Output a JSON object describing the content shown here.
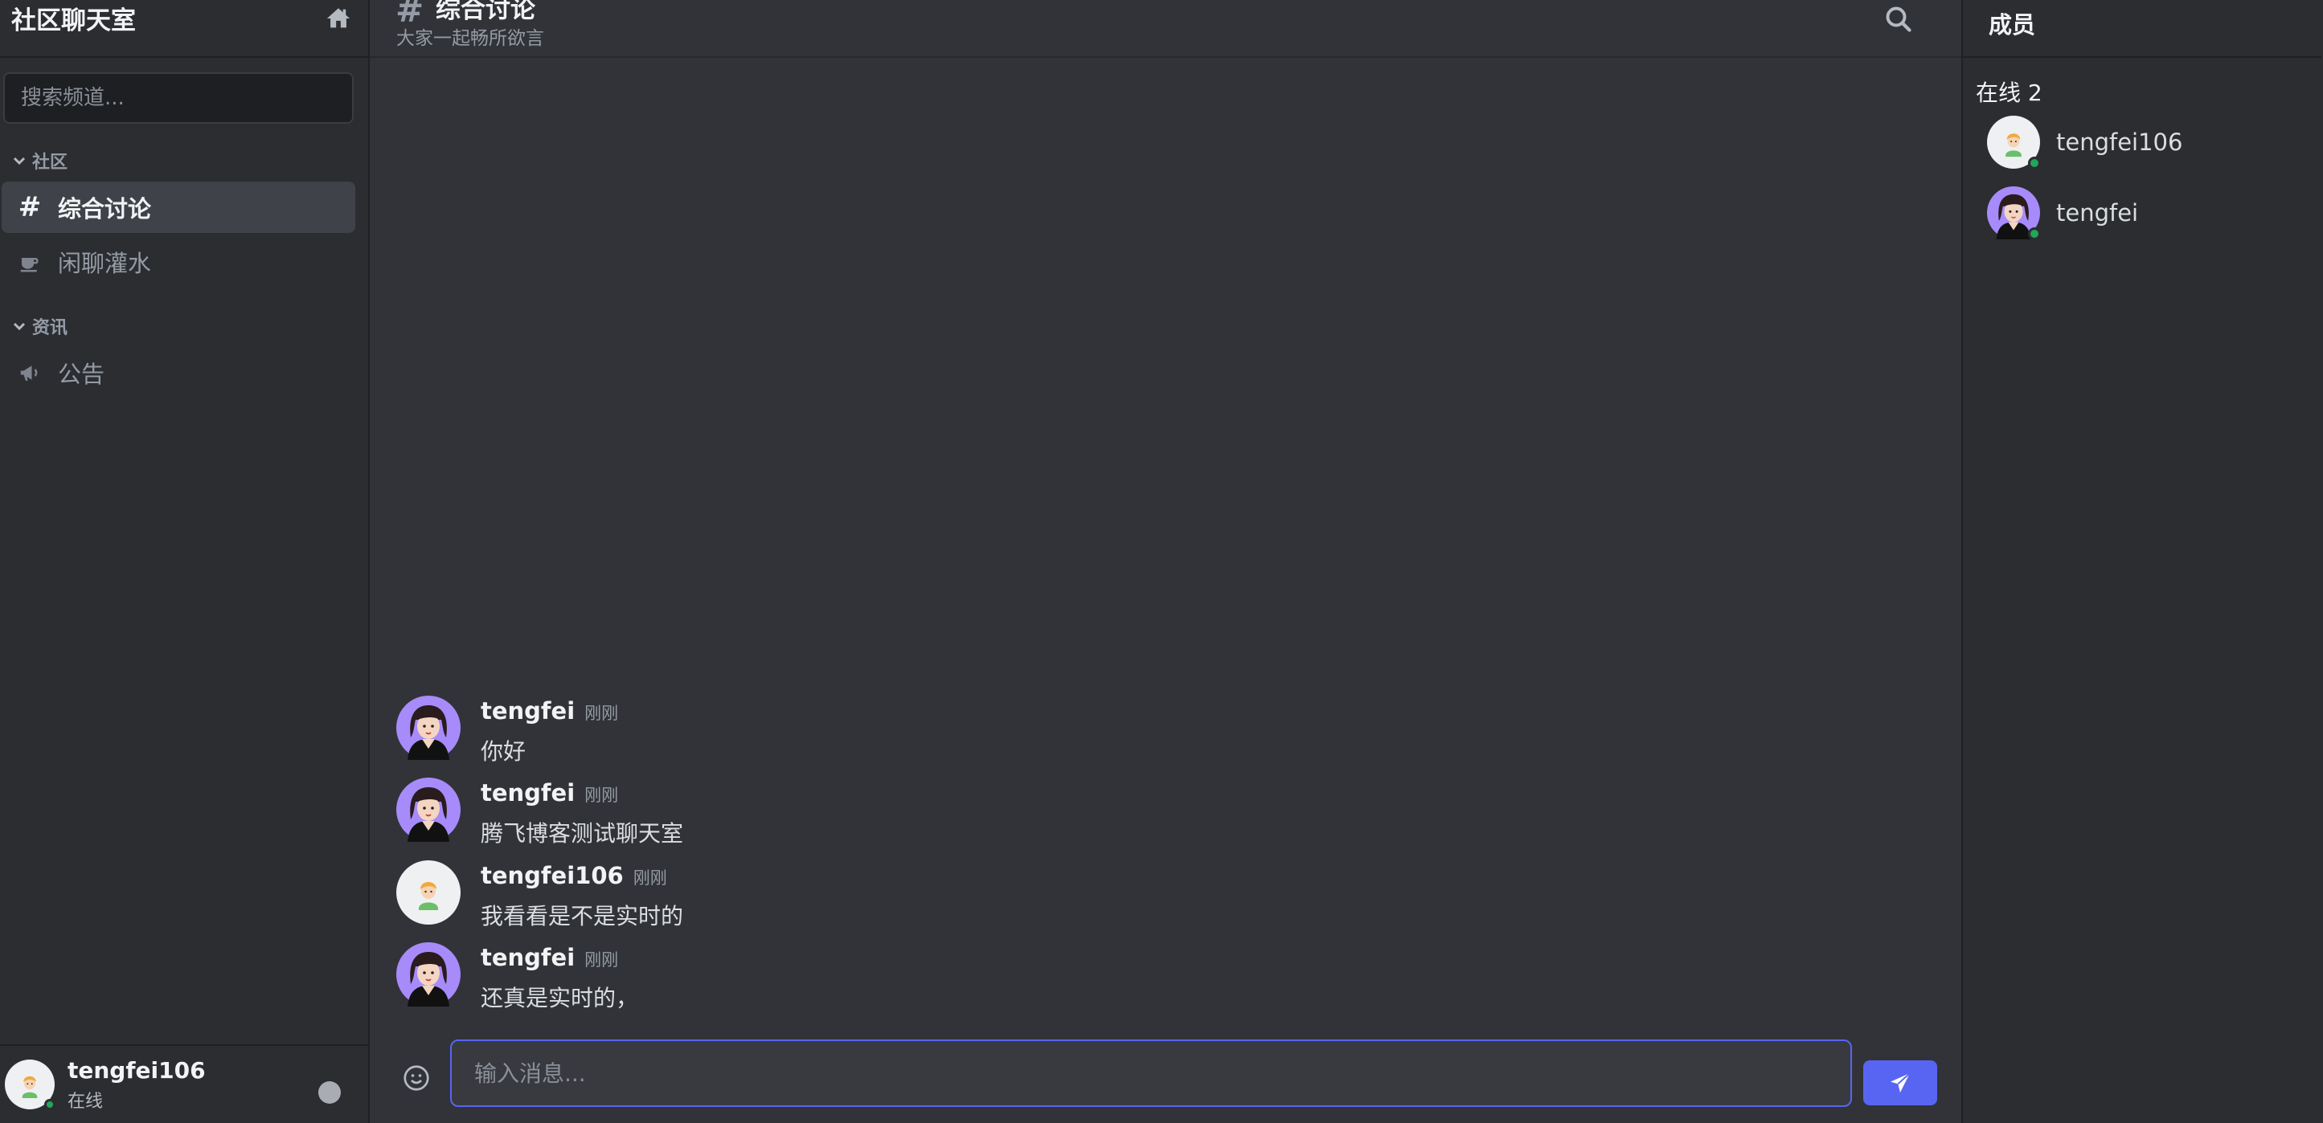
{
  "sidebar": {
    "title": "社区聊天室",
    "search_placeholder": "搜索频道...",
    "categories": [
      {
        "name": "社区",
        "channels": [
          {
            "name": "综合讨论",
            "icon": "hash-icon",
            "active": true
          },
          {
            "name": "闲聊灌水",
            "icon": "coffee-icon",
            "active": false
          }
        ]
      },
      {
        "name": "资讯",
        "channels": [
          {
            "name": "公告",
            "icon": "megaphone-icon",
            "active": false
          }
        ]
      }
    ],
    "user": {
      "name": "tengfei106",
      "status": "在线"
    }
  },
  "channel": {
    "hash": "#",
    "name": "综合讨论",
    "description": "大家一起畅所欲言"
  },
  "messages": [
    {
      "user": "tengfei",
      "time": "刚刚",
      "text": "你好",
      "avatar": "girl-avatar"
    },
    {
      "user": "tengfei",
      "time": "刚刚",
      "text": "腾飞博客测试聊天室",
      "avatar": "girl-avatar"
    },
    {
      "user": "tengfei106",
      "time": "刚刚",
      "text": "我看看是不是实时的",
      "avatar": "boy-avatar"
    },
    {
      "user": "tengfei",
      "time": "刚刚",
      "text": "还真是实时的，",
      "avatar": "girl-avatar"
    }
  ],
  "composer": {
    "placeholder": "输入消息..."
  },
  "members_panel": {
    "title": "成员",
    "online_label": "在线 2",
    "members": [
      {
        "name": "tengfei106",
        "avatar": "boy-avatar"
      },
      {
        "name": "tengfei",
        "avatar": "girl-avatar"
      }
    ]
  },
  "colors": {
    "accent": "#5865f2",
    "online": "#23a55a",
    "sidebar_bg": "#2b2d31",
    "main_bg": "#313338"
  }
}
